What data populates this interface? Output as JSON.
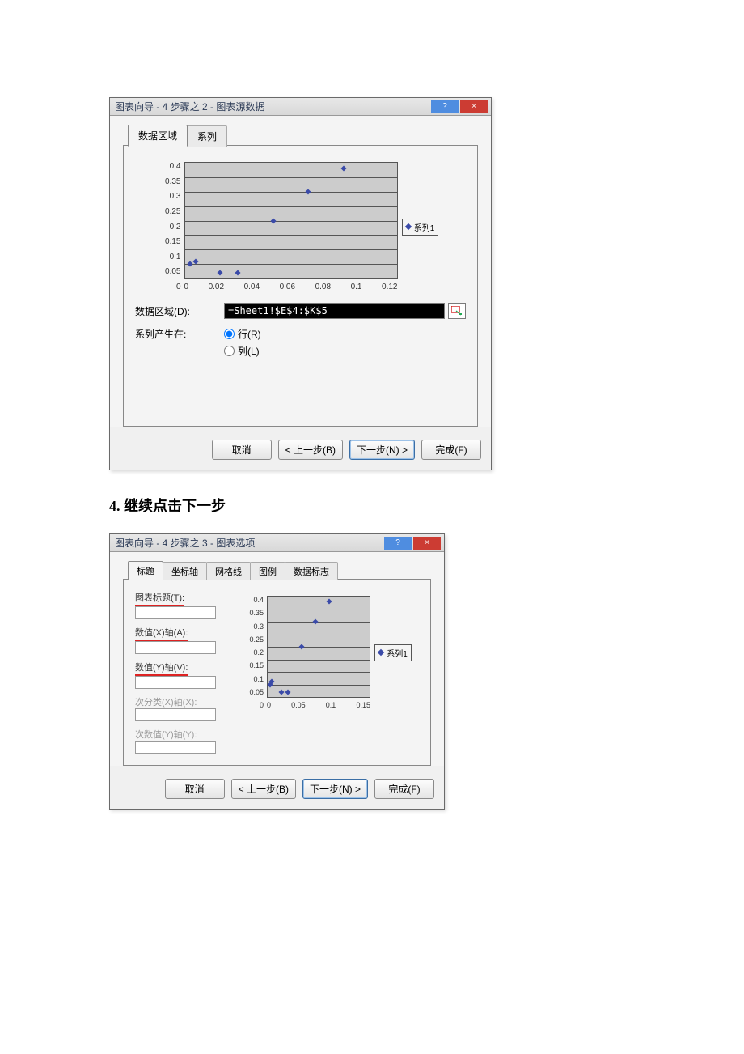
{
  "caption": "4. 继续点击下一步",
  "dialog1": {
    "title": "图表向导 - 4 步骤之 2 - 图表源数据",
    "help_icon_text": "?",
    "close_icon_text": "×",
    "tabs": {
      "data_range": "数据区域",
      "series": "系列"
    },
    "data_range_label": "数据区域(D):",
    "data_range_value": "=Sheet1!$E$4:$K$5",
    "series_in_label": "系列产生在:",
    "radio_rows": "行(R)",
    "radio_cols": "列(L)",
    "buttons": {
      "cancel": "取消",
      "back": "< 上一步(B)",
      "next": "下一步(N) >",
      "finish": "完成(F)"
    }
  },
  "dialog2": {
    "title": "图表向导 - 4 步骤之 3 - 图表选项",
    "tabs": {
      "titles": "标题",
      "axes": "坐标轴",
      "grid": "网格线",
      "legend": "图例",
      "labels": "数据标志"
    },
    "chart_title_label": "图表标题(T):",
    "x_axis_label": "数值(X)轴(A):",
    "y_axis_label": "数值(Y)轴(V):",
    "secondary_cat_label": "次分类(X)轴(X):",
    "secondary_val_label": "次数值(Y)轴(Y):",
    "buttons": {
      "cancel": "取消",
      "back": "< 上一步(B)",
      "next": "下一步(N) >",
      "finish": "完成(F)"
    }
  },
  "chart_data": {
    "type": "scatter",
    "series": [
      {
        "name": "系列1",
        "x": [
          0.003,
          0.006,
          0.02,
          0.03,
          0.05,
          0.07,
          0.09
        ],
        "y": [
          0.05,
          0.06,
          0.02,
          0.02,
          0.2,
          0.3,
          0.38
        ]
      }
    ],
    "xlabel": "",
    "ylabel": "",
    "xlim": [
      0,
      0.12
    ],
    "ylim": [
      0,
      0.4
    ],
    "xticks": [
      0,
      0.02,
      0.04,
      0.06,
      0.08,
      0.1,
      0.12
    ],
    "yticks": [
      0,
      0.05,
      0.1,
      0.15,
      0.2,
      0.25,
      0.3,
      0.35,
      0.4
    ],
    "title": "",
    "legend_position": "right"
  },
  "chart2_data": {
    "type": "scatter",
    "series": [
      {
        "name": "系列1",
        "x": [
          0.003,
          0.006,
          0.02,
          0.03,
          0.05,
          0.07,
          0.09
        ],
        "y": [
          0.05,
          0.06,
          0.02,
          0.02,
          0.2,
          0.3,
          0.38
        ]
      }
    ],
    "xlim": [
      0,
      0.15
    ],
    "ylim": [
      0,
      0.4
    ],
    "xticks": [
      0,
      0.05,
      0.1,
      0.15
    ],
    "yticks": [
      0,
      0.05,
      0.1,
      0.15,
      0.2,
      0.25,
      0.3,
      0.35,
      0.4
    ]
  }
}
